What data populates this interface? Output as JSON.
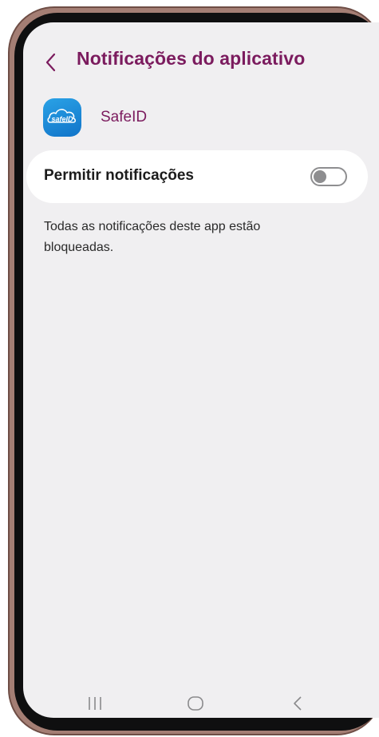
{
  "header": {
    "title": "Notificações do aplicativo",
    "back_icon": "chevron-left-icon"
  },
  "app": {
    "name": "SafeID",
    "icon_text": "safeID",
    "icon": "safeid-app-icon",
    "icon_color": "#1a8ad8"
  },
  "allow_notifications": {
    "label": "Permitir notificações",
    "enabled": false
  },
  "message": "Todas as notificações deste app estão bloqueadas.",
  "nav_bar": {
    "recents_icon": "recents-icon",
    "home_icon": "home-icon",
    "back_icon": "back-icon"
  },
  "colors": {
    "accent": "#7b1b5e",
    "background": "#f0eff1",
    "card": "#ffffff",
    "toggle_off": "#8e8e90"
  }
}
